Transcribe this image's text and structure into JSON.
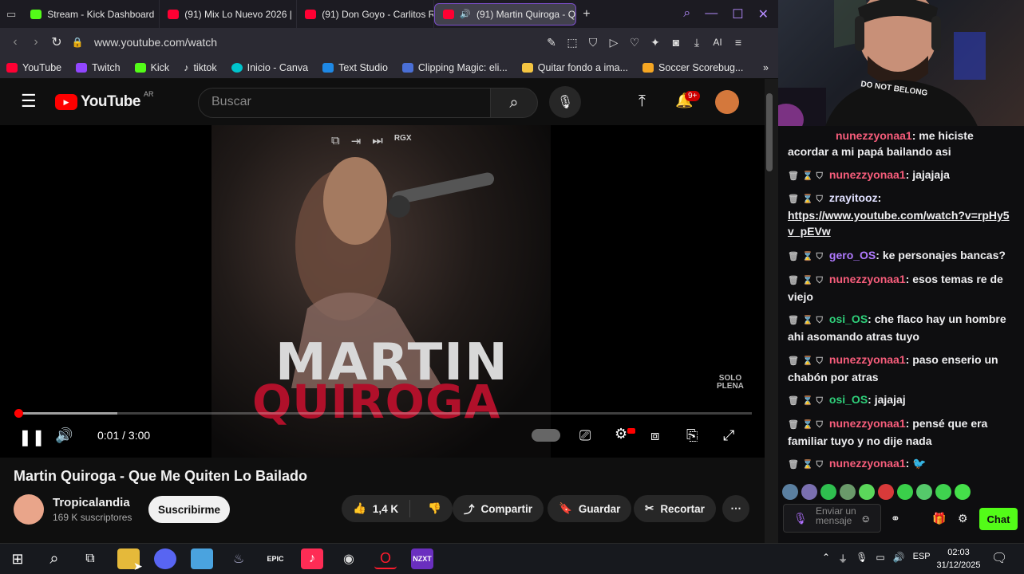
{
  "browser": {
    "tabs": [
      {
        "label": "Stream - Kick Dashboard",
        "icon": "kick-icon"
      },
      {
        "label": "(91) Mix Lo Nuevo 2026 |",
        "icon": "youtube-icon"
      },
      {
        "label": "(91) Don Goyo - Carlitos R",
        "icon": "youtube-icon"
      },
      {
        "label": "(91) Martin Quiroga - Q",
        "icon": "youtube-icon",
        "active": true
      }
    ],
    "new_tab": "+",
    "url": "www.youtube.com/watch",
    "bookmarks": [
      {
        "label": "YouTube",
        "color": "#ff0033"
      },
      {
        "label": "Twitch",
        "color": "#9146ff"
      },
      {
        "label": "Kick",
        "color": "#53fc18"
      },
      {
        "label": "tiktok",
        "color": "#ffffff"
      },
      {
        "label": "Inicio - Canva",
        "color": "#00c4cc"
      },
      {
        "label": "Text Studio",
        "color": "#1e88e5"
      },
      {
        "label": "Clipping Magic: eli...",
        "color": "#4a6fd6"
      },
      {
        "label": "Quitar fondo a ima...",
        "color": "#f4c542"
      },
      {
        "label": "Soccer Scorebug...",
        "color": "#f5a623"
      }
    ]
  },
  "youtube": {
    "logo": "YouTube",
    "region": "AR",
    "search_placeholder": "Buscar",
    "notif_count": "9+",
    "video": {
      "poster_line1": "MARTIN",
      "poster_line2": "QUIROGA",
      "watermark": "SOLO\nPLENA",
      "player_badge": "RGX",
      "time": "0:01 / 3:00",
      "progress": 0.005,
      "buffered": 0.14
    },
    "title": "Martin Quiroga - Que Me Quiten Lo Bailado",
    "channel": "Tropicalandia",
    "subscribers": "169 K suscriptores",
    "subscribe_label": "Suscribirme",
    "likes": "1,4 K",
    "share_label": "Compartir",
    "save_label": "Guardar",
    "clip_label": "Recortar"
  },
  "chat": {
    "messages": [
      {
        "user": "nunezzyonaa1",
        "text": "me hiciste",
        "cls": "u-n",
        "cont": "acordar a mi papá bailando asi"
      },
      {
        "user": "nunezzyonaa1",
        "text": "jajajaja",
        "cls": "u-n"
      },
      {
        "user": "zrayitooz",
        "text": "",
        "cls": "u-z",
        "link": "https://www.youtube.com/watch?v=rpHy5v_pEVw"
      },
      {
        "user": "gero_OS",
        "text": "ke personajes bancas?",
        "cls": "u-g"
      },
      {
        "user": "nunezzyonaa1",
        "text": "esos temas re de viejo",
        "cls": "u-n"
      },
      {
        "user": "osi_OS",
        "text": "che flaco hay un hombre ahi asomando atras tuyo",
        "cls": "u-o"
      },
      {
        "user": "nunezzyonaa1",
        "text": "paso enserio un chabón por atras",
        "cls": "u-n"
      },
      {
        "user": "osi_OS",
        "text": "jajajaj",
        "cls": "u-o"
      },
      {
        "user": "nunezzyonaa1",
        "text": "pensé que era familiar tuyo y no dije nada",
        "cls": "u-n"
      },
      {
        "user": "nunezzyonaa1",
        "text": "",
        "cls": "u-n"
      }
    ],
    "input_placeholder": "Enviar un mensaje",
    "send_label": "Chat"
  },
  "webcam": {
    "shirt_text": "DO NOT BELONG"
  },
  "taskbar": {
    "lang": "ESP",
    "time": "02:03",
    "date": "31/12/2025"
  },
  "colors": {
    "accent_red": "#ff0000",
    "kick_green": "#53fc18"
  }
}
